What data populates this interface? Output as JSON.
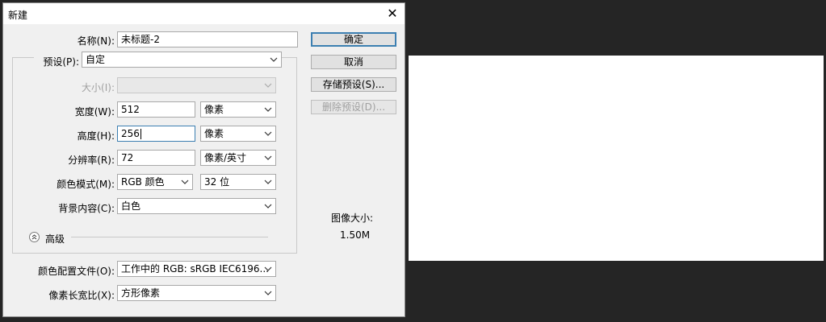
{
  "dialog": {
    "title": "新建",
    "close_glyph": "✕"
  },
  "form": {
    "name_label": "名称(N):",
    "name_value": "未标题-2",
    "preset_label": "预设(P):",
    "preset_value": "自定",
    "size_label": "大小(I):",
    "size_value": "",
    "width_label": "宽度(W):",
    "width_value": "512",
    "width_unit": "像素",
    "height_label": "高度(H):",
    "height_value": "256",
    "height_unit": "像素",
    "resolution_label": "分辨率(R):",
    "resolution_value": "72",
    "resolution_unit": "像素/英寸",
    "color_mode_label": "颜色模式(M):",
    "color_mode_value": "RGB 颜色",
    "bit_depth_value": "32 位",
    "background_label": "背景内容(C):",
    "background_value": "白色",
    "advanced_label": "高级",
    "color_profile_label": "颜色配置文件(O):",
    "color_profile_value": "工作中的 RGB: sRGB IEC6196...",
    "pixel_aspect_label": "像素长宽比(X):",
    "pixel_aspect_value": "方形像素"
  },
  "buttons": {
    "ok": "确定",
    "cancel": "取消",
    "save_preset": "存储预设(S)...",
    "delete_preset": "删除预设(D)..."
  },
  "image_size": {
    "label": "图像大小:",
    "value": "1.50M"
  },
  "colors": {
    "background": "#252525",
    "dialog": "#f0f0f0",
    "focus_border": "#3c7fb1"
  },
  "icons": {
    "dropdown": "chevron-down-icon",
    "advanced": "double-chevron-up-icon",
    "close": "close-icon"
  }
}
